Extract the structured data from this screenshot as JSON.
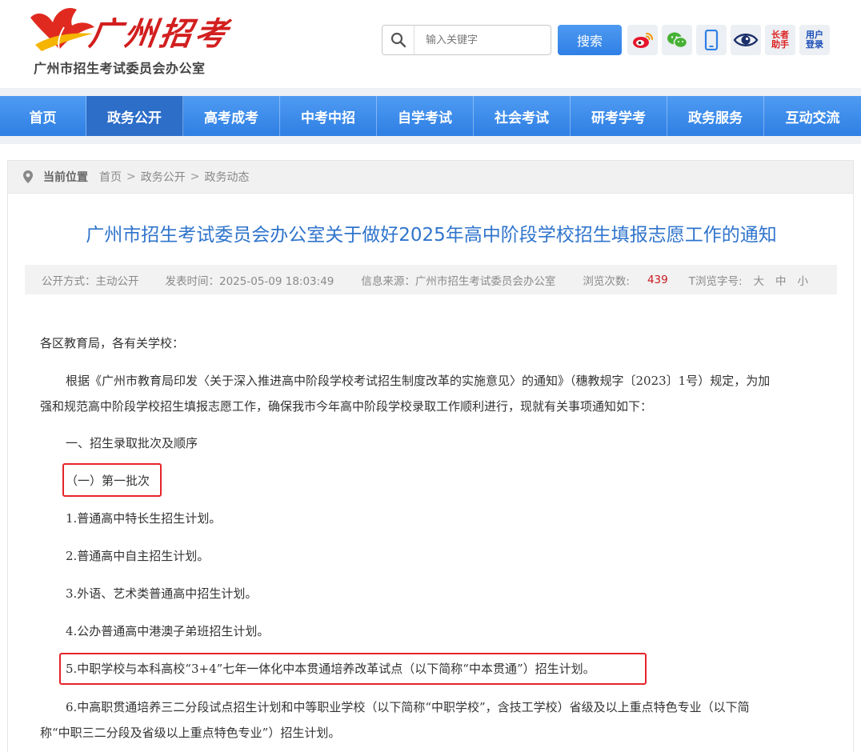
{
  "header": {
    "logo_text": "广州招考",
    "org_name": "广州市招生考试委员会办公室",
    "search_placeholder": "输入关键字",
    "search_button": "搜索",
    "elder_mode": "长者助手",
    "user_login": "用户登录",
    "colors": {
      "brand_red": "#d21f1f",
      "accent_blue": "#2f7fe6"
    }
  },
  "nav": {
    "items": [
      "首页",
      "政务公开",
      "高考成考",
      "中考中招",
      "自学考试",
      "社会考试",
      "研考学考",
      "政务服务",
      "互动交流"
    ],
    "active": "政务公开"
  },
  "breadcrumb": {
    "label": "当前位置",
    "items": [
      "首页",
      "政务公开",
      "政务动态"
    ]
  },
  "article": {
    "title": "广州市招生考试委员会办公室关于做好2025年高中阶段学校招生填报志愿工作的通知",
    "meta": {
      "disclosure": "公开方式：主动公开",
      "publish_time": "发表时间：2025-05-09 18:03:49",
      "source": "信息来源：广州市招生考试委员会办公室",
      "views_label": "浏览次数:",
      "views": "439",
      "font_label": "T浏览字号:",
      "font_large": "大",
      "font_medium": "中",
      "font_small": "小"
    },
    "salutation": "各区教育局，各有关学校：",
    "intro_line1": "根据《广州市教育局印发〈关于深入推进高中阶段学校考试招生制度改革的实施意见〉的通知》（穗教规字〔2023〕1号）规定，为加",
    "intro_line2": "强和规范高中阶段学校招生填报志愿工作，确保我市今年高中阶段学校录取工作顺利进行，现就有关事项通知如下：",
    "section1": "一、招生录取批次及顺序",
    "batch1": "（一）第一批次",
    "items": [
      "1.普通高中特长生招生计划。",
      "2.普通高中自主招生计划。",
      "3.外语、艺术类普通高中招生计划。",
      "4.公办普通高中港澳子弟班招生计划。",
      "5.中职学校与本科高校“3+4”七年一体化中本贯通培养改革试点（以下简称“中本贯通”）招生计划。"
    ],
    "item6_line1": "6.中高职贯通培养三二分段试点招生计划和中等职业学校（以下简称“中职学校”，含技工学校）省级及以上重点特色专业（以下简",
    "item6_line2": "称“中职三二分段及省级以上重点特色专业”）招生计划。"
  }
}
